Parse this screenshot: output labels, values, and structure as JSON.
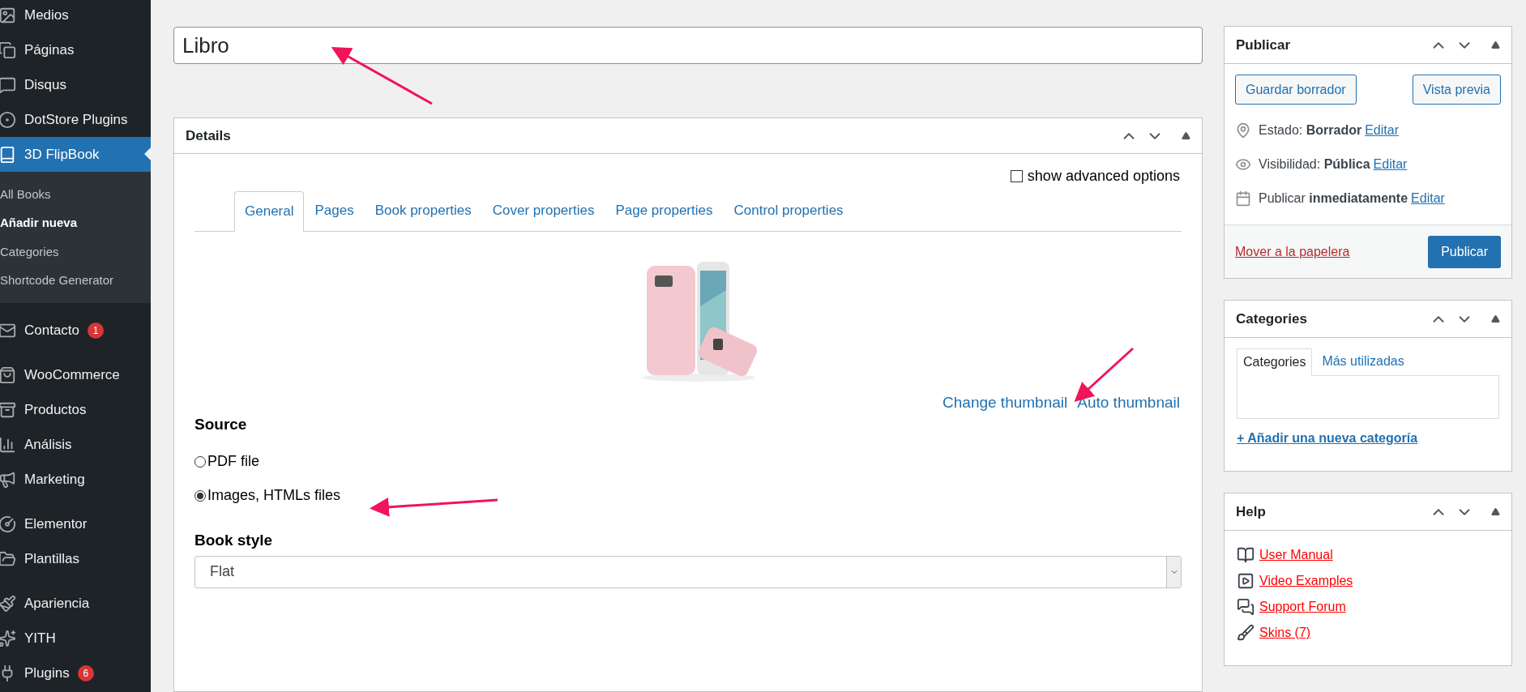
{
  "sidebar": {
    "groups": [
      [
        {
          "label": "Medios",
          "selected": false
        },
        {
          "label": "Páginas",
          "selected": false
        },
        {
          "label": "Disqus",
          "selected": false
        },
        {
          "label": "DotStore Plugins",
          "selected": false
        },
        {
          "label": "3D FlipBook",
          "selected": true,
          "children": [
            {
              "label": "All Books",
              "selected": false
            },
            {
              "label": "Añadir nueva",
              "selected": true
            },
            {
              "label": "Categories",
              "selected": false
            },
            {
              "label": "Shortcode Generator",
              "selected": false
            }
          ]
        }
      ],
      [
        {
          "label": "Contacto",
          "selected": false,
          "badge": "1"
        }
      ],
      [
        {
          "label": "WooCommerce",
          "selected": false
        },
        {
          "label": "Productos",
          "selected": false
        },
        {
          "label": "Análisis",
          "selected": false
        },
        {
          "label": "Marketing",
          "selected": false
        }
      ],
      [
        {
          "label": "Elementor",
          "selected": false
        },
        {
          "label": "Plantillas",
          "selected": false
        }
      ],
      [
        {
          "label": "Apariencia",
          "selected": false
        },
        {
          "label": "YITH",
          "selected": false
        },
        {
          "label": "Plugins",
          "selected": false,
          "badge": "6"
        }
      ]
    ]
  },
  "title_field": {
    "value": "Libro"
  },
  "details": {
    "title": "Details",
    "advanced": {
      "label": "show advanced options",
      "checked": false
    },
    "tabs": [
      {
        "label": "General",
        "selected": true
      },
      {
        "label": "Pages",
        "selected": false
      },
      {
        "label": "Book properties",
        "selected": false
      },
      {
        "label": "Cover properties",
        "selected": false
      },
      {
        "label": "Page properties",
        "selected": false
      },
      {
        "label": "Control properties",
        "selected": false
      }
    ],
    "thumbnail": {
      "kind": "picture"
    },
    "thumbnail_links": [
      "Change thumbnail",
      "Auto thumbnail"
    ],
    "source": {
      "label": "Source",
      "options": [
        {
          "label": "PDF file",
          "selected": false
        },
        {
          "label": "Images, HTMLs files",
          "selected": true
        }
      ]
    },
    "book_style": {
      "label": "Book style",
      "value": "Flat"
    }
  },
  "publish": {
    "title": "Publicar",
    "buttons": [
      "Guardar borrador",
      "Vista previa"
    ],
    "rows": [
      {
        "label": "Estado:",
        "value": "Borrador",
        "link": "Editar"
      },
      {
        "label": "Visibilidad:",
        "value": "Pública",
        "link": "Editar"
      },
      {
        "label": "Publicar",
        "value": "inmediatamente",
        "link": "Editar"
      }
    ],
    "trash": "Mover a la papelera",
    "submit": "Publicar"
  },
  "categories": {
    "title": "Categories",
    "tabs": [
      {
        "label": "Categories",
        "selected": true
      },
      {
        "label": "Más utilizadas",
        "selected": false
      }
    ],
    "add_link": "+ Añadir una nueva categoría"
  },
  "help": {
    "title": "Help",
    "links": [
      "User Manual",
      "Video Examples",
      "Support Forum",
      "Skins (7)"
    ]
  }
}
